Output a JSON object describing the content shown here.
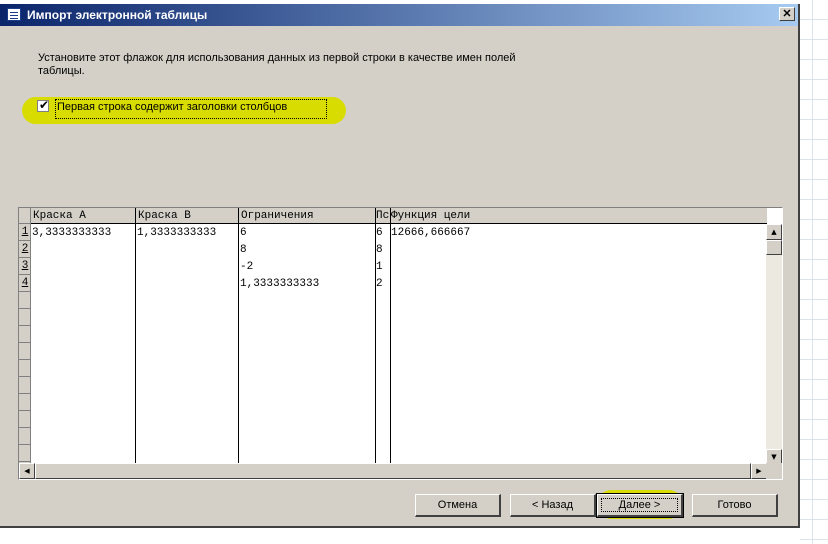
{
  "window": {
    "title": "Импорт электронной таблицы",
    "close_glyph": "✕"
  },
  "instruction": "Установите этот флажок для использования данных из первой строки в качестве имен полей таблицы.",
  "checkbox": {
    "checked": true,
    "label": "Первая строка содержит заголовки столбцов"
  },
  "grid": {
    "columns": [
      "Краска А",
      "Краска В",
      "Ограничения",
      "Пс",
      "Функция цели"
    ],
    "row_numbers": [
      "1",
      "2",
      "3",
      "4"
    ],
    "rows": [
      [
        "3,3333333333",
        "1,3333333333",
        "6",
        "6",
        "12666,666667"
      ],
      [
        "",
        "",
        "8",
        "8",
        ""
      ],
      [
        "",
        "",
        "-2",
        "1",
        ""
      ],
      [
        "",
        "",
        "1,3333333333",
        "2",
        ""
      ]
    ]
  },
  "scroll": {
    "up": "▲",
    "down": "▼",
    "left": "◀",
    "right": "▶"
  },
  "buttons": {
    "cancel": "Отмена",
    "back": "< Назад",
    "next": "Далее >",
    "finish": "Готово"
  },
  "colors": {
    "highlight": "#d8dc00",
    "title_start": "#0a246a",
    "title_end": "#a6caf0",
    "dialog_bg": "#d4d0c8"
  }
}
